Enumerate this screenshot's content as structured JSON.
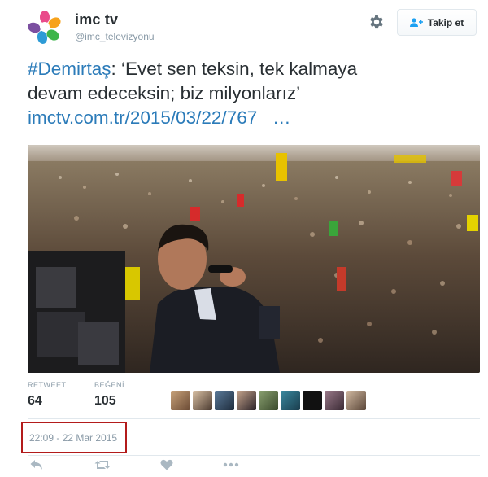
{
  "user": {
    "name": "imc tv",
    "handle": "@imc_televizyonu"
  },
  "follow_button": {
    "label": "Takip et"
  },
  "tweet": {
    "hashtag": "#Demirtaş",
    "text_line1_rest": ": ‘Evet sen teksin, tek kalmaya",
    "text_line2": "devam edeceksin; biz milyonlarız’",
    "link": "imctv.com.tr/2015/03/22/767",
    "link_ellipsis": "…"
  },
  "stats": {
    "retweet_label": "RETWEET",
    "retweet_count": "64",
    "like_label": "BEĞENİ",
    "like_count": "105"
  },
  "timestamp": "22:09 - 22 Mar 2015",
  "icons": {
    "settings": "gear-icon",
    "follow": "add-user-icon",
    "reply": "reply-icon",
    "retweet": "retweet-icon",
    "like": "heart-icon",
    "more": "more-icon"
  },
  "colors": {
    "link": "#2b7bb9",
    "highlight_box": "#b31b1b",
    "muted": "#8899a6"
  }
}
